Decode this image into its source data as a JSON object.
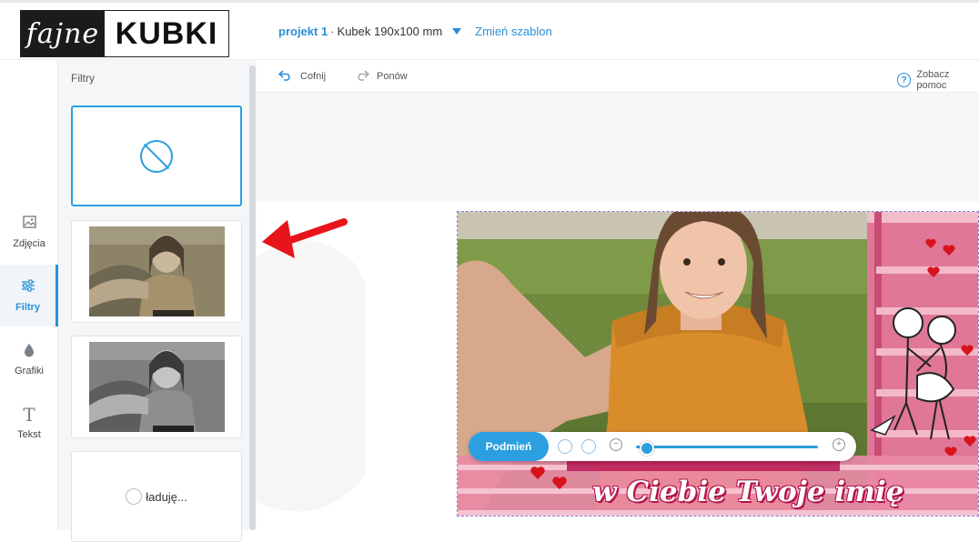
{
  "brand": {
    "logo_left": "fajne",
    "logo_right": "KUBKI"
  },
  "header": {
    "project_name": "projekt 1",
    "separator": "·",
    "product": "Kubek 190x100 mm",
    "change_template": "Zmień szablon"
  },
  "sidebar": {
    "items": [
      {
        "label": "Zdjęcia",
        "icon": "image-icon"
      },
      {
        "label": "Filtry",
        "icon": "sliders-icon",
        "active": true
      },
      {
        "label": "Grafiki",
        "icon": "drop-icon"
      },
      {
        "label": "Tekst",
        "icon": "text-icon"
      }
    ]
  },
  "panel": {
    "title": "Filtry",
    "loading_label": "ładuję..."
  },
  "toolbar": {
    "undo": "Cofnij",
    "redo": "Ponów",
    "help": "Zobacz pomoc"
  },
  "editor": {
    "replace_button": "Podmień",
    "design_text": "w Ciebie Twoje imię",
    "zoom_level": 0.05
  },
  "colors": {
    "accent": "#2b9fe0",
    "arrow": "#e8141b",
    "design_pink": "#e06a8c"
  }
}
